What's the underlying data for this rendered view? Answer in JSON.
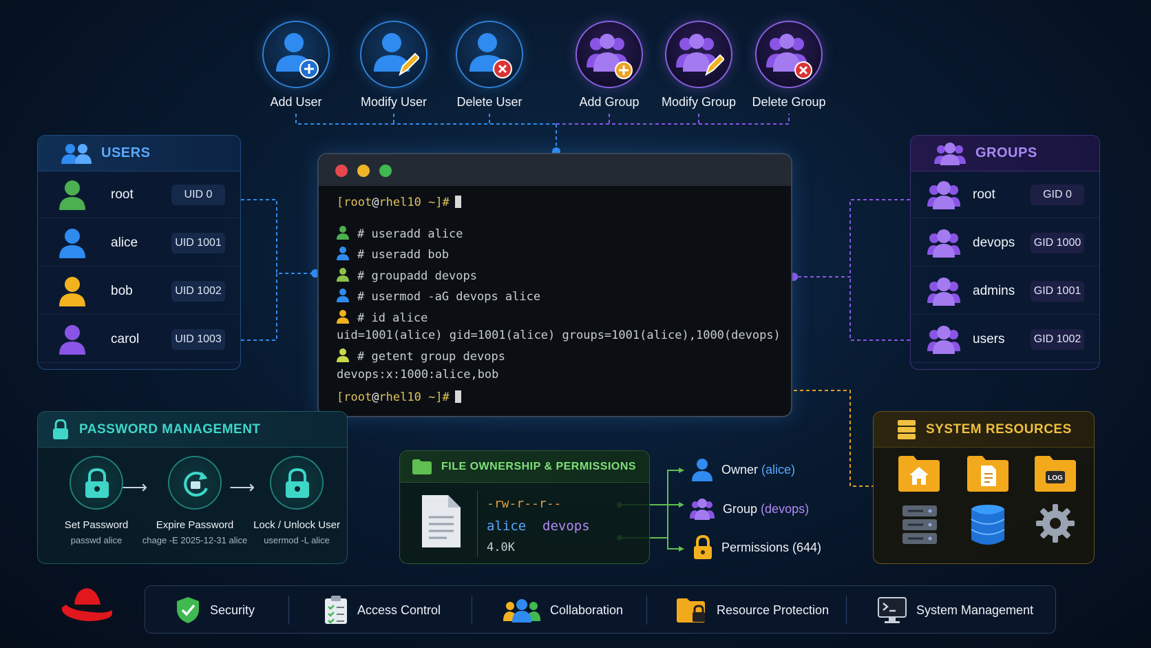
{
  "actions": {
    "add_user": "Add User",
    "modify_user": "Modify User",
    "delete_user": "Delete User",
    "add_group": "Add Group",
    "modify_group": "Modify Group",
    "delete_group": "Delete Group"
  },
  "users": {
    "title": "USERS",
    "rows": [
      {
        "name": "root",
        "badge": "UID 0",
        "color": "#4caf50"
      },
      {
        "name": "alice",
        "badge": "UID 1001",
        "color": "#2f8bf0"
      },
      {
        "name": "bob",
        "badge": "UID 1002",
        "color": "#f2b21f"
      },
      {
        "name": "carol",
        "badge": "UID 1003",
        "color": "#8a55e6"
      }
    ]
  },
  "groups": {
    "title": "GROUPS",
    "rows": [
      {
        "name": "root",
        "badge": "GID 0"
      },
      {
        "name": "devops",
        "badge": "GID 1000"
      },
      {
        "name": "admins",
        "badge": "GID 1001"
      },
      {
        "name": "users",
        "badge": "GID 1002"
      }
    ]
  },
  "terminal": {
    "prompt_user": "[root",
    "prompt_at": "@",
    "prompt_host": "rhel10 ~]#",
    "lines": [
      {
        "text": "# useradd alice",
        "icon": "#4caf50"
      },
      {
        "text": "# useradd bob",
        "icon": "#2f8bf0"
      },
      {
        "text": "# groupadd devops",
        "icon": "#8bc34a"
      },
      {
        "text": "# usermod -aG devops alice",
        "icon": "#2f8bf0"
      },
      {
        "text": "# id alice",
        "icon": "#f2b21f"
      },
      {
        "text": "uid=1001(alice) gid=1001(alice) groups=1001(alice),1000(devops)"
      },
      {
        "text": "# getent group devops",
        "icon": "#c8d84a"
      },
      {
        "text": "devops:x:1000:alice,bob"
      }
    ]
  },
  "password": {
    "title": "PASSWORD MANAGEMENT",
    "steps": [
      {
        "label": "Set Password",
        "cmd": "passwd alice"
      },
      {
        "label": "Expire Password",
        "cmd": "chage -E 2025-12-31 alice"
      },
      {
        "label": "Lock / Unlock User",
        "cmd": "usermod -L alice"
      }
    ],
    "arrow": "⟶"
  },
  "file": {
    "title": "FILE OWNERSHIP & PERMISSIONS",
    "perms": "-rw-r--r--",
    "owner": "alice",
    "group": "devops",
    "size": "4.0K",
    "owner_label": "Owner",
    "owner_value": "(alice)",
    "group_label": "Group",
    "group_value": "(devops)",
    "perm_label": "Permissions (644)"
  },
  "resources": {
    "title": "SYSTEM RESOURCES",
    "log_label": "LOG"
  },
  "bottom": {
    "security": "Security",
    "access": "Access Control",
    "collab": "Collaboration",
    "resource": "Resource Protection",
    "system": "System Management"
  },
  "colors": {
    "blue": "#2f8bf0",
    "purple": "#8a55e6",
    "green": "#4caf50",
    "gold": "#f0c040",
    "teal": "#3fd6c8"
  }
}
